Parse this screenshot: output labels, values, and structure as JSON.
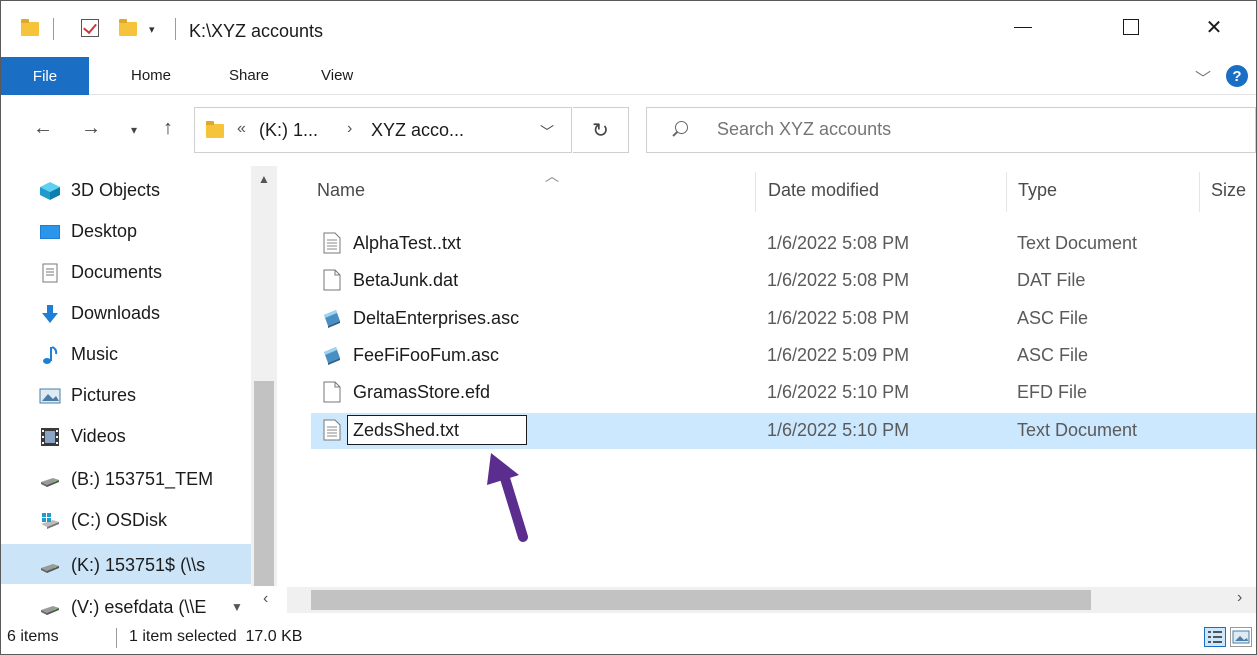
{
  "window": {
    "title": "K:\\XYZ accounts",
    "controls": {
      "minimize": "—",
      "maximize": "",
      "close": "✕"
    }
  },
  "ribbon": {
    "tabs": [
      "File",
      "Home",
      "Share",
      "View"
    ],
    "help": "?"
  },
  "navigation": {
    "breadcrumb": {
      "overflow": "«",
      "parts": [
        "(K:) 1...",
        "XYZ acco..."
      ],
      "separator": "›"
    },
    "search": {
      "placeholder": "Search XYZ accounts"
    }
  },
  "sidebar": {
    "items": [
      {
        "label": "3D Objects",
        "icon": "cube-3d-icon"
      },
      {
        "label": "Desktop",
        "icon": "desktop-icon"
      },
      {
        "label": "Documents",
        "icon": "documents-icon"
      },
      {
        "label": "Downloads",
        "icon": "download-arrow-icon"
      },
      {
        "label": "Music",
        "icon": "music-note-icon"
      },
      {
        "label": "Pictures",
        "icon": "pictures-icon"
      },
      {
        "label": "Videos",
        "icon": "film-icon"
      },
      {
        "label": "(B:) 153751_TEM",
        "icon": "network-drive-icon"
      },
      {
        "label": "(C:) OSDisk",
        "icon": "windows-drive-icon"
      },
      {
        "label": "(K:) 153751$ (\\\\s",
        "icon": "network-drive-icon",
        "selected": true
      },
      {
        "label": "(V:) esefdata (\\\\E",
        "icon": "network-drive-icon"
      }
    ]
  },
  "file_list": {
    "columns": [
      "Name",
      "Date modified",
      "Type",
      "Size"
    ],
    "rows": [
      {
        "name": "AlphaTest..txt",
        "date": "1/6/2022 5:08 PM",
        "type": "Text Document",
        "icon": "text-file-icon"
      },
      {
        "name": "BetaJunk.dat",
        "date": "1/6/2022 5:08 PM",
        "type": "DAT File",
        "icon": "blank-file-icon"
      },
      {
        "name": "DeltaEnterprises.asc",
        "date": "1/6/2022 5:08 PM",
        "type": "ASC File",
        "icon": "asc-file-icon"
      },
      {
        "name": "FeeFiFooFum.asc",
        "date": "1/6/2022 5:09 PM",
        "type": "ASC File",
        "icon": "asc-file-icon"
      },
      {
        "name": "GramasStore.efd",
        "date": "1/6/2022 5:10 PM",
        "type": "EFD File",
        "icon": "blank-file-icon"
      },
      {
        "name": "ZedsShed.txt",
        "date": "1/6/2022 5:10 PM",
        "type": "Text Document",
        "icon": "text-file-icon",
        "selected": true,
        "renaming": true
      }
    ]
  },
  "status": {
    "item_count": "6 items",
    "selection": "1 item selected  17.0 KB"
  },
  "colors": {
    "accent": "#1a6fc4",
    "selection": "#cce8ff",
    "annotation_arrow": "#5b2d8e"
  }
}
